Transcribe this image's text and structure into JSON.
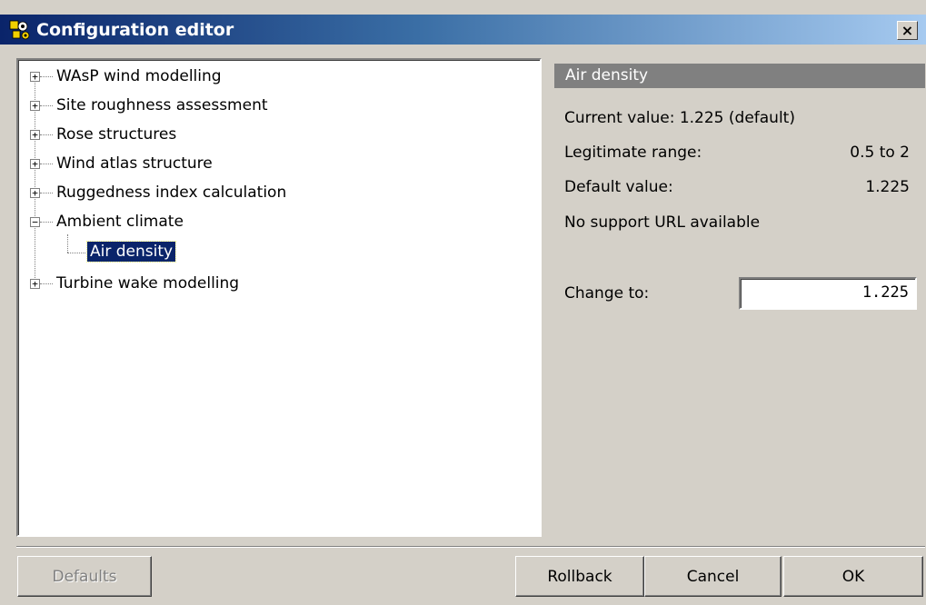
{
  "window": {
    "title": "Configuration editor",
    "close_label": "×",
    "icon": "config-app-icon"
  },
  "tree": {
    "items": [
      {
        "label": "WAsP wind modelling",
        "expander": "+"
      },
      {
        "label": "Site roughness assessment",
        "expander": "+"
      },
      {
        "label": "Rose structures",
        "expander": "+"
      },
      {
        "label": "Wind atlas structure",
        "expander": "+"
      },
      {
        "label": "Ruggedness index calculation",
        "expander": "+"
      },
      {
        "label": "Ambient climate",
        "expander": "−",
        "expanded": true,
        "children": [
          {
            "label": "Air density",
            "selected": true
          }
        ]
      },
      {
        "label": "Turbine wake modelling",
        "expander": "+"
      }
    ]
  },
  "property": {
    "header": "Air density",
    "current_value": "Current value: 1.225 (default)",
    "range_label": "Legitimate range:",
    "range_value": "0.5 to 2",
    "default_label": "Default value:",
    "default_value": "1.225",
    "support_url": "No support URL available",
    "change_label": "Change to:",
    "change_value": "1.225"
  },
  "buttons": {
    "defaults": "Defaults",
    "rollback": "Rollback",
    "cancel": "Cancel",
    "ok": "OK"
  },
  "colors": {
    "titlebar_start": "#0a246a",
    "titlebar_end": "#a6caf0",
    "selection": "#0a246a",
    "panel_header": "#808080",
    "face": "#d4d0c8"
  }
}
